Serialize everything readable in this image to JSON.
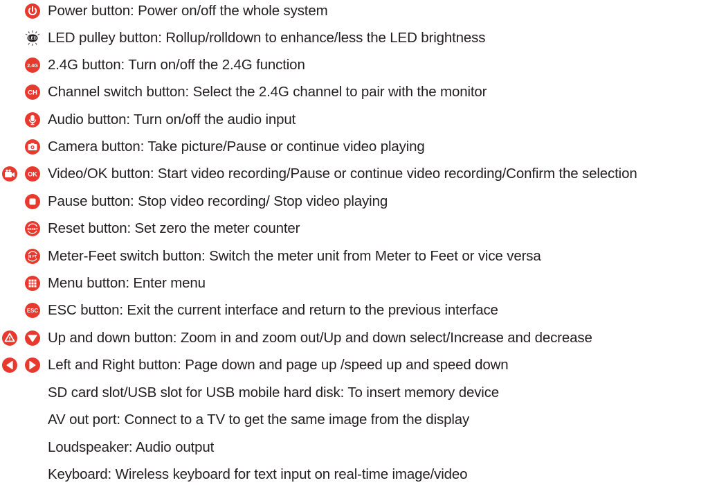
{
  "accent_color": "#e8392e",
  "items": [
    {
      "icon": "power-icon",
      "text": "Power button: Power on/off the whole system"
    },
    {
      "icon": "led-pulley-icon",
      "text": "LED pulley button: Rollup/rolldown to enhance/less the LED brightness",
      "icon_label": "LED"
    },
    {
      "icon": "2-4g-icon",
      "text": "2.4G button: Turn on/off the 2.4G function",
      "icon_label": "2.4G"
    },
    {
      "icon": "channel-icon",
      "text": "Channel switch button: Select the 2.4G channel to pair with the monitor",
      "icon_label": "CH"
    },
    {
      "icon": "microphone-icon",
      "text": "Audio button: Turn on/off the audio input"
    },
    {
      "icon": "camera-icon",
      "text": "Camera button: Take picture/Pause or continue video playing"
    },
    {
      "icon": "video-ok-icon",
      "text": "Video/OK button: Start video recording/Pause or continue video recording/Confirm the selection",
      "icon_label": "OK"
    },
    {
      "icon": "stop-icon",
      "text": "Pause button: Stop video recording/ Stop video playing"
    },
    {
      "icon": "reset-icon",
      "text": "Reset button: Set zero the meter counter",
      "icon_label": "RESET"
    },
    {
      "icon": "meter-feet-icon",
      "text": "Meter-Feet switch button: Switch the meter unit from Meter to Feet or vice versa",
      "icon_label": "M FT"
    },
    {
      "icon": "menu-grid-icon",
      "text": "Menu button: Enter menu"
    },
    {
      "icon": "esc-icon",
      "text": "ESC button: Exit the current interface and return to the previous interface",
      "icon_label": "ESC"
    },
    {
      "icon": "up-down-icon",
      "text": "Up and down button: Zoom in and zoom out/Up and down select/Increase and decrease"
    },
    {
      "icon": "left-right-icon",
      "text": "Left and Right button: Page down and page up /speed up and speed down"
    },
    {
      "icon": "",
      "text": "SD card slot/USB slot for USB mobile hard disk: To insert memory device"
    },
    {
      "icon": "",
      "text": "AV out port: Connect to a TV to get the same image from the display"
    },
    {
      "icon": "",
      "text": "Loudspeaker:  Audio output"
    },
    {
      "icon": "",
      "text": "Keyboard: Wireless keyboard for text input on real-time image/video"
    }
  ]
}
